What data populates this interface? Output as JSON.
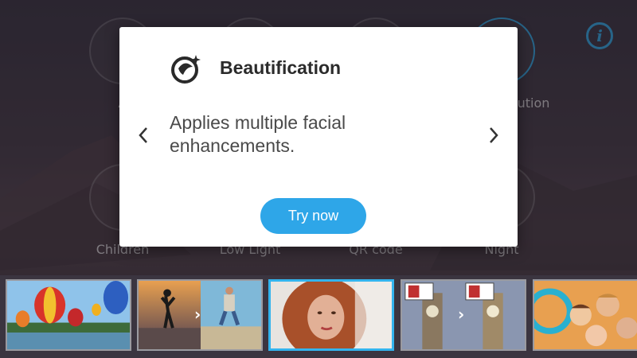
{
  "modes": {
    "row1": [
      {
        "label": "A",
        "icon": "mode-a-icon"
      },
      {
        "label": "",
        "icon": "mode-icon"
      },
      {
        "label": "",
        "icon": "mode-icon"
      },
      {
        "label": "ution",
        "icon": "super-resolution-icon"
      }
    ],
    "row2": [
      {
        "label": "Children",
        "icon": "children-icon"
      },
      {
        "label": "Low Light",
        "icon": "low-light-icon"
      },
      {
        "label": "QR code",
        "icon": "qr-code-icon"
      },
      {
        "label": "Night",
        "icon": "night-icon"
      }
    ]
  },
  "info_button": {
    "glyph": "i",
    "color": "#38a9e6"
  },
  "dialog": {
    "title": "Beautification",
    "description": "Applies multiple facial enhancements.",
    "prev_glyph": "‹",
    "next_glyph": "›",
    "cta": "Try now",
    "accent": "#2ea6e8"
  },
  "filmstrip": {
    "thumbnails": [
      {
        "name": "hot-air-balloons"
      },
      {
        "name": "jumping-people"
      },
      {
        "name": "portrait-woman",
        "selected": true
      },
      {
        "name": "big-ben"
      },
      {
        "name": "children-group"
      }
    ],
    "chevron": "›"
  }
}
